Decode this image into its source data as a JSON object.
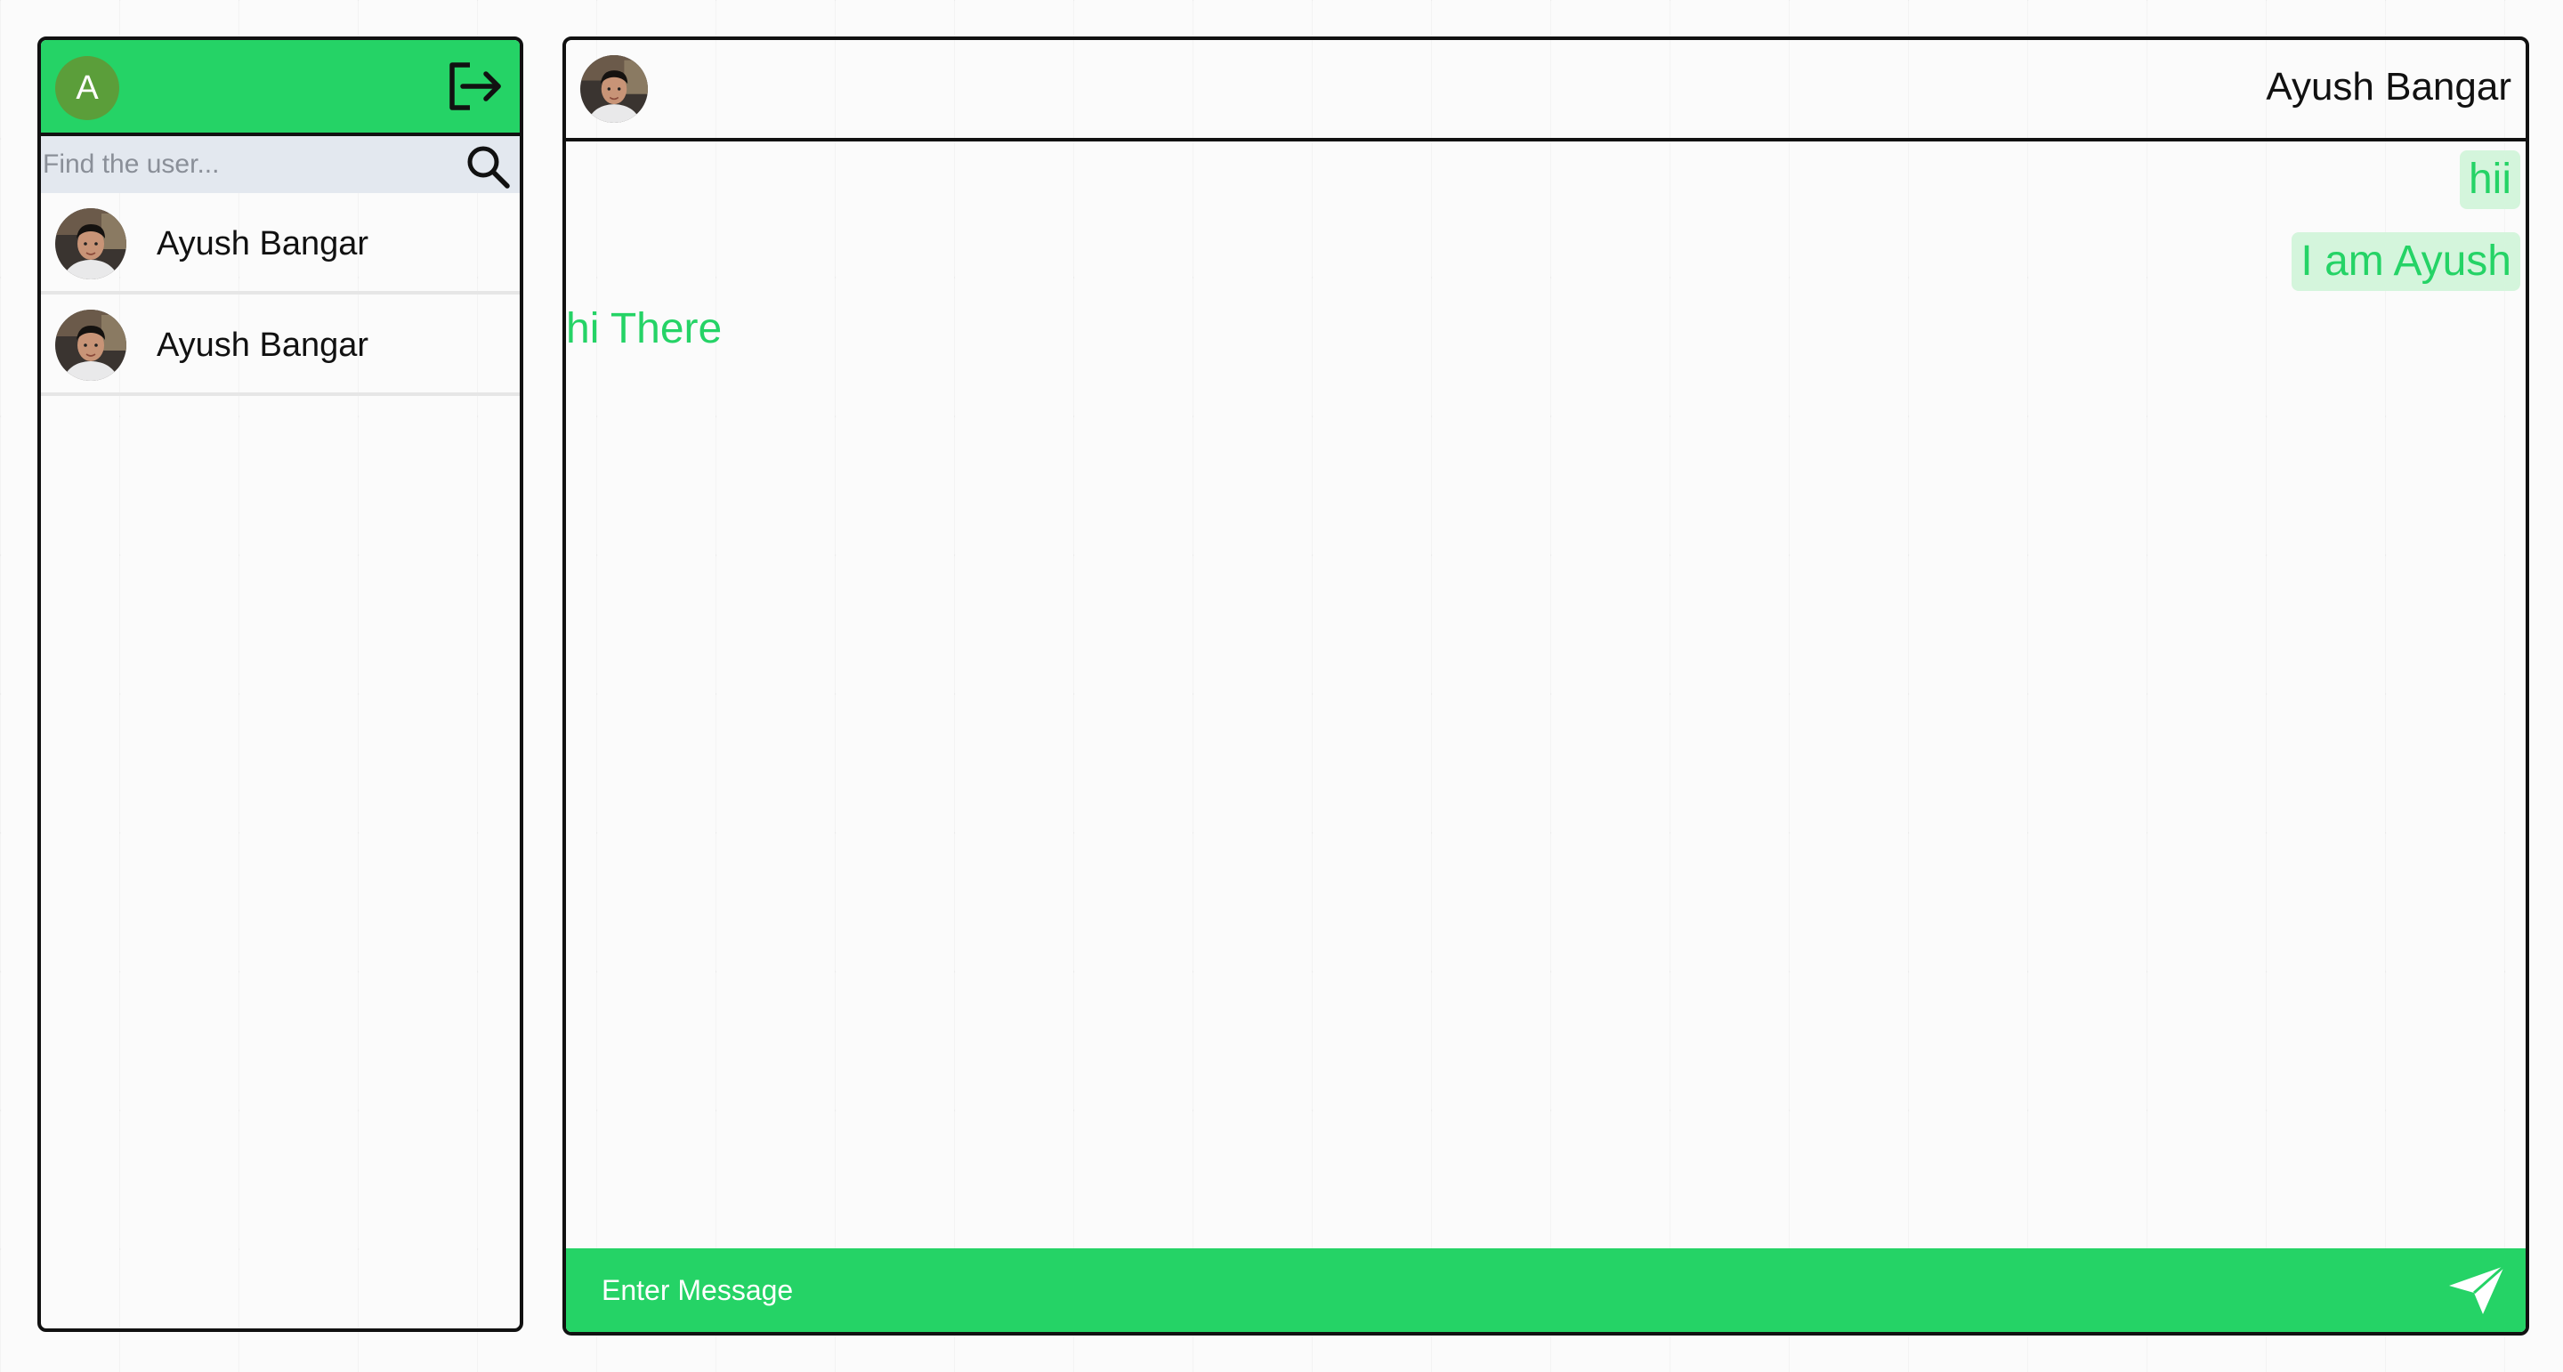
{
  "colors": {
    "accent": "#25d366",
    "avatar_bg": "#5b9e3a",
    "search_bg": "#e3e8ef",
    "bubble_out_bg": "#d4f5dc",
    "border": "#111111"
  },
  "sidebar": {
    "current_user_initial": "A",
    "logout_icon": "logout-icon",
    "search": {
      "placeholder": "Find the user...",
      "value": "",
      "icon": "search-icon"
    },
    "users": [
      {
        "name": "Ayush Bangar",
        "avatar": "contact-photo"
      },
      {
        "name": "Ayush Bangar",
        "avatar": "contact-photo"
      }
    ]
  },
  "chat": {
    "contact_name": "Ayush Bangar",
    "contact_avatar": "contact-photo",
    "messages": [
      {
        "text": "hii",
        "direction": "outgoing"
      },
      {
        "text": "I am Ayush",
        "direction": "outgoing"
      },
      {
        "text": "hi There",
        "direction": "incoming"
      }
    ],
    "composer": {
      "placeholder": "Enter Message",
      "value": "",
      "send_icon": "send-icon"
    }
  }
}
